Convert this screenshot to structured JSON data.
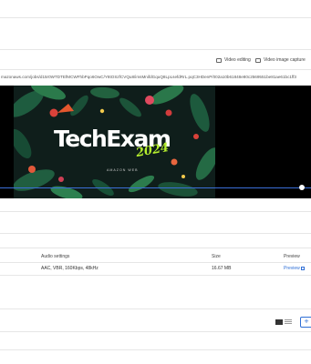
{
  "toolbar": {
    "video_editing": "Video editing",
    "video_image_capture": "Video image capture"
  },
  "player": {
    "url": "mazonaws.com/jobs/d15r0WTDTEfMCWFhbPqo6OwC/Y8tOSzfCVQu8/imsMnifdGquQ8LpLsefdRrL.pqC3HDenP/002a10b61848e80c2569551be81ae61bc1ff3",
    "poster_title": "TechExam",
    "poster_year": "2024",
    "poster_brand": "AMAZON WEB",
    "progress": 0.97
  },
  "table": {
    "headers": {
      "audio_settings": "Audio settings",
      "size": "Size",
      "preview": "Preview"
    },
    "rows": [
      {
        "audio_settings": "AAC, VBR, 160Kbps, 48kHz",
        "size": "16.67 MB",
        "preview": "Preview"
      }
    ]
  },
  "add_button": "+",
  "colors": {
    "accent": "#2f6fd6",
    "progress": "#3b6fd8",
    "year": "#b5ee2e"
  }
}
